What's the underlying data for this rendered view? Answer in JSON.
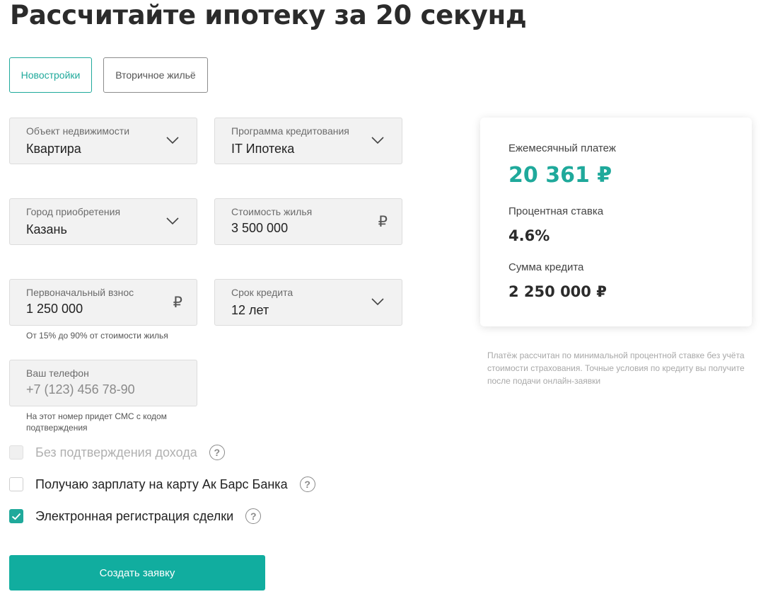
{
  "page_title": "Рассчитайте ипотеку за 20 секунд",
  "tabs": [
    {
      "label": "Новостройки",
      "active": true
    },
    {
      "label": "Вторичное жильё",
      "active": false
    }
  ],
  "fields": {
    "property": {
      "label": "Объект недвижимости",
      "value": "Квартира",
      "icon": "chevron-down-icon"
    },
    "program": {
      "label": "Программа кредитования",
      "value": "IT Ипотека",
      "icon": "chevron-down-icon"
    },
    "city": {
      "label": "Город приобретения",
      "value": "Казань",
      "icon": "chevron-down-icon"
    },
    "price": {
      "label": "Стоимость жилья",
      "value": "3 500 000",
      "currency": "₽"
    },
    "down_payment": {
      "label": "Первоначальный взнос",
      "value": "1 250 000",
      "currency": "₽",
      "hint": "От 15% до 90% от стоимости жилья"
    },
    "term": {
      "label": "Срок кредита",
      "value": "12 лет",
      "icon": "chevron-down-icon"
    },
    "phone": {
      "label": "Ваш телефон",
      "placeholder": "+7 (123) 456 78-90",
      "hint_line1": "На этот номер придет СМС с кодом",
      "hint_line2": "подтверждения"
    }
  },
  "options": [
    {
      "label": "Без подтверждения дохода",
      "checked": false,
      "disabled": true,
      "help": "?"
    },
    {
      "label": "Получаю зарплату на карту Ак Барс Банка",
      "checked": false,
      "disabled": false,
      "help": "?"
    },
    {
      "label": "Электронная регистрация сделки",
      "checked": true,
      "disabled": false,
      "help": "?"
    }
  ],
  "submit_label": "Создать заявку",
  "result": {
    "monthly_label": "Ежемесячный платеж",
    "monthly_value": "20 361 ₽",
    "rate_label": "Процентная ставка",
    "rate_value": "4.6%",
    "amount_label": "Сумма кредита",
    "amount_value": "2 250 000 ₽"
  },
  "disclaimer": "Платёж рассчитан по минимальной процентной ставке без учёта стоимости страхования. Точные условия по кредиту вы получите после подачи онлайн-заявки",
  "colors": {
    "accent": "#11ad9f",
    "accent_text": "#1fa99b",
    "field_bg": "#f2f2f2"
  }
}
